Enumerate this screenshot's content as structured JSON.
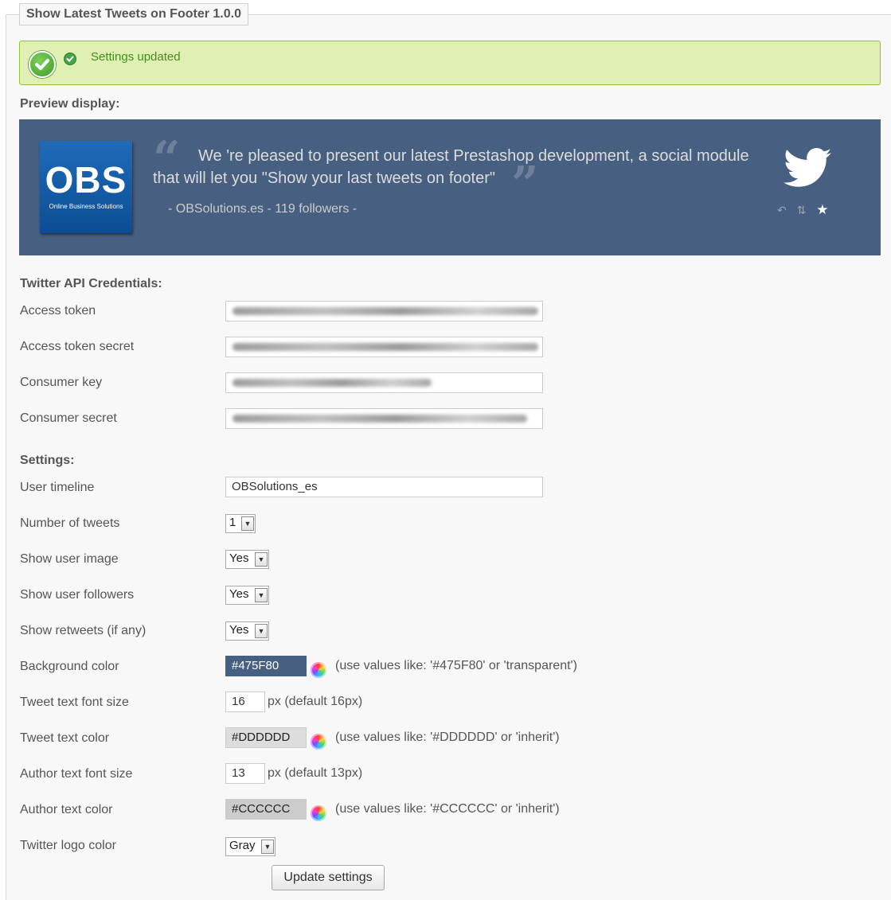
{
  "module": {
    "title": "Show Latest Tweets on Footer 1.0.0"
  },
  "confirmation": {
    "message": "Settings updated"
  },
  "preview": {
    "heading": "Preview display:",
    "logo_text": "OBS",
    "logo_subtitle": "Online Business Solutions",
    "tweet_text": "We 're pleased to present our latest Prestashop development, a social module that will let you \"Show your last tweets on footer\"",
    "author": "- OBSolutions.es - 119 followers -",
    "background_color": "#475F80",
    "tweet_color": "#DDDDDD",
    "author_color": "#CCCCCC"
  },
  "credentials": {
    "heading": "Twitter API Credentials:",
    "access_token_label": "Access token",
    "access_token_secret_label": "Access token secret",
    "consumer_key_label": "Consumer key",
    "consumer_secret_label": "Consumer secret"
  },
  "settings": {
    "heading": "Settings:",
    "user_timeline_label": "User timeline",
    "user_timeline_value": "OBSolutions_es",
    "number_of_tweets_label": "Number of tweets",
    "number_of_tweets_value": "1",
    "show_user_image_label": "Show user image",
    "show_user_image_value": "Yes",
    "show_user_followers_label": "Show user followers",
    "show_user_followers_value": "Yes",
    "show_retweets_label": "Show retweets (if any)",
    "show_retweets_value": "Yes",
    "background_color_label": "Background color",
    "background_color_value": "#475F80",
    "background_color_hint": "(use values like: '#475F80' or 'transparent')",
    "tweet_font_size_label": "Tweet text font size",
    "tweet_font_size_value": "16",
    "tweet_font_size_hint": "px (default 16px)",
    "tweet_color_label": "Tweet text color",
    "tweet_color_value": "#DDDDDD",
    "tweet_color_hint": "(use values like: '#DDDDDD' or 'inherit')",
    "author_font_size_label": "Author text font size",
    "author_font_size_value": "13",
    "author_font_size_hint": "px (default 13px)",
    "author_color_label": "Author text color",
    "author_color_value": "#CCCCCC",
    "author_color_hint": "(use values like: '#CCCCCC' or 'inherit')",
    "logo_color_label": "Twitter logo color",
    "logo_color_value": "Gray",
    "update_button": "Update settings"
  },
  "colors": {
    "success_bg": "#DFF0B2",
    "success_border": "#8DC23C",
    "preview_bg": "#475F80"
  }
}
